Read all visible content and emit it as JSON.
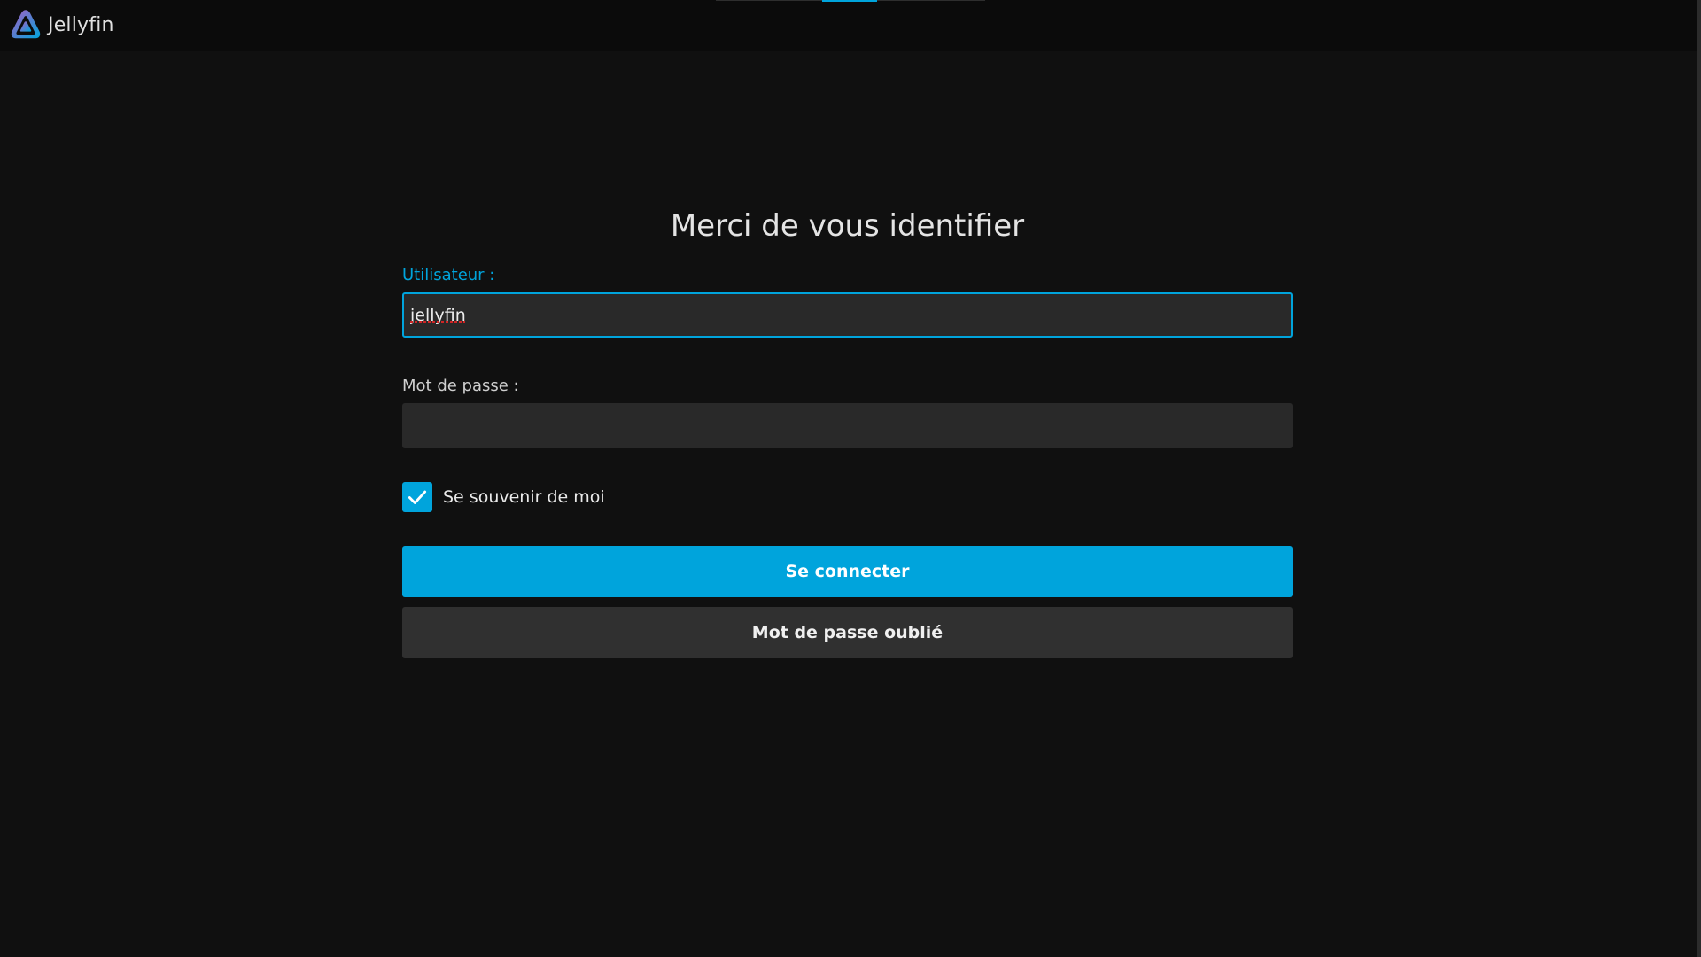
{
  "app": {
    "name": "Jellyfin",
    "accent_color": "#00a4dc"
  },
  "header": {
    "logo_icon": "jellyfin-logo-icon"
  },
  "login": {
    "title": "Merci de vous identifier",
    "username_label": "Utilisateur :",
    "username_value": "jellyfin",
    "password_label": "Mot de passe :",
    "password_value": "",
    "remember_label": "Se souvenir de moi",
    "remember_checked": true,
    "submit_label": "Se connecter",
    "forgot_label": "Mot de passe oublié"
  }
}
